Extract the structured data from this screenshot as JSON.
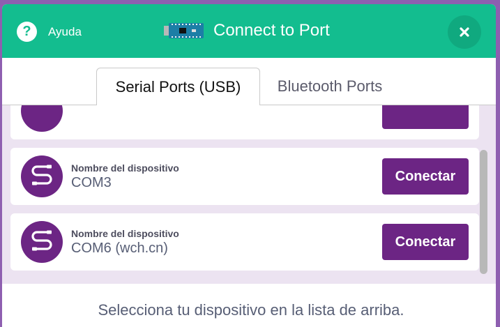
{
  "header": {
    "help_label": "Ayuda",
    "title": "Connect to Port",
    "icons": [
      "help-icon",
      "board-icon",
      "close-icon"
    ],
    "color": "#13bd8f"
  },
  "tabs": [
    {
      "label": "Serial Ports (USB)",
      "active": true
    },
    {
      "label": "Bluetooth Ports",
      "active": false
    }
  ],
  "devices": [
    {
      "label": "Nombre del dispositivo",
      "name": "COM3",
      "button": "Conectar"
    },
    {
      "label": "Nombre del dispositivo",
      "name": "COM6 (wch.cn)",
      "button": "Conectar"
    }
  ],
  "footer": {
    "hint": "Selecciona tu dispositivo en la lista de arriba."
  },
  "colors": {
    "accent": "#6c2584",
    "list_background": "#ece3f1"
  }
}
